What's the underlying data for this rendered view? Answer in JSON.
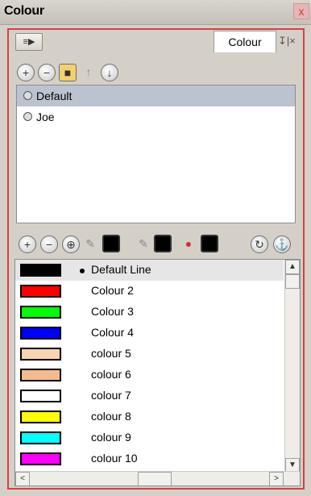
{
  "window": {
    "title": "Colour",
    "close_label": "x"
  },
  "header": {
    "menu_label": "≡▶",
    "tab_label": "Colour",
    "tab_tools": "↧|×"
  },
  "palette_toolbar": [
    "+",
    "−",
    "■",
    "↑",
    "↓"
  ],
  "palettes": [
    {
      "label": "Default",
      "selected": true
    },
    {
      "label": "Joe",
      "selected": false
    }
  ],
  "colour_toolbar": [
    "+",
    "−",
    "⊕",
    "✎",
    "■",
    "✎",
    "■",
    "●",
    "■",
    "↻",
    "⚓"
  ],
  "colours": [
    {
      "name": "Default Line",
      "swatch": "#000000",
      "selected": true
    },
    {
      "name": "Colour 2",
      "swatch": "#ff0000"
    },
    {
      "name": "Colour 3",
      "swatch": "#00ff00"
    },
    {
      "name": "Colour 4",
      "swatch": "#0000ff"
    },
    {
      "name": "colour 5",
      "swatch": "#f8d4b0"
    },
    {
      "name": "colour 6",
      "swatch": "#f2bc8e"
    },
    {
      "name": "colour 7",
      "swatch": "#ffffff"
    },
    {
      "name": "colour 8",
      "swatch": "#ffff00"
    },
    {
      "name": "colour 9",
      "swatch": "#00ffff"
    },
    {
      "name": "colour 10",
      "swatch": "#ff00ff"
    }
  ],
  "scroll": {
    "up": "▲",
    "down": "▼",
    "left": "<",
    "right": ">"
  }
}
